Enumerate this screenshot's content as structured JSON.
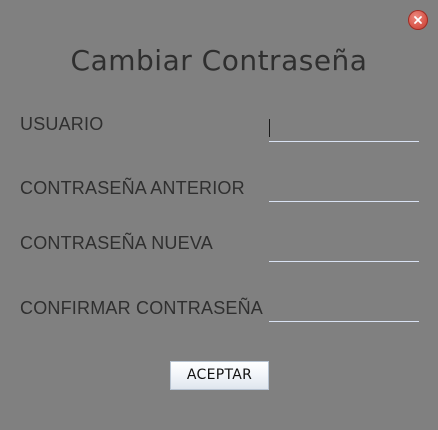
{
  "dialog": {
    "title": "Cambiar Contraseña",
    "close_icon": "close-icon",
    "close_color": "#d9584c"
  },
  "form": {
    "fields": [
      {
        "label": "USUARIO",
        "value": ""
      },
      {
        "label": "CONTRASEÑA ANTERIOR",
        "value": ""
      },
      {
        "label": "CONTRASEÑA NUEVA",
        "value": ""
      },
      {
        "label": "CONFIRMAR CONTRASEÑA",
        "value": ""
      }
    ],
    "accept_label": "ACEPTAR"
  },
  "colors": {
    "background": "#808080",
    "text": "#2f2f2f",
    "field_underline": "#d9e2f3"
  }
}
